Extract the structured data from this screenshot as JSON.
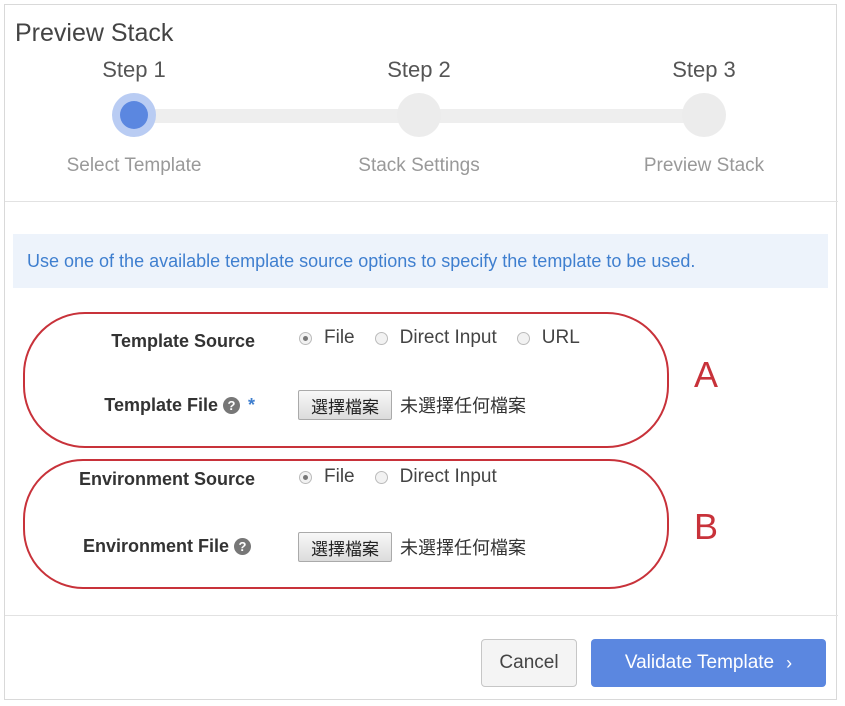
{
  "dialog": {
    "title": "Preview Stack"
  },
  "stepper": {
    "steps": [
      {
        "label": "Step 1",
        "description": "Select Template",
        "active": true
      },
      {
        "label": "Step 2",
        "description": "Stack Settings",
        "active": false
      },
      {
        "label": "Step 3",
        "description": "Preview Stack",
        "active": false
      }
    ]
  },
  "info": {
    "text": "Use one of the available template source options to specify the template to be used."
  },
  "template": {
    "source_label": "Template Source",
    "source_options": [
      "File",
      "Direct Input",
      "URL"
    ],
    "source_selected": "File",
    "file_label": "Template File",
    "required_mark": "*",
    "file_button": "選擇檔案",
    "file_status": "未選擇任何檔案"
  },
  "environment": {
    "source_label": "Environment Source",
    "source_options": [
      "File",
      "Direct Input"
    ],
    "source_selected": "File",
    "file_label": "Environment File",
    "file_button": "選擇檔案",
    "file_status": "未選擇任何檔案"
  },
  "annotations": {
    "a": "A",
    "b": "B"
  },
  "help_icon": "?",
  "footer": {
    "cancel": "Cancel",
    "validate": "Validate Template",
    "validate_chevron": "›"
  },
  "colors": {
    "accent": "#5b87e0",
    "annotation": "#c8323a",
    "info_text": "#3f7fcf",
    "info_bg": "#edf3fb"
  }
}
